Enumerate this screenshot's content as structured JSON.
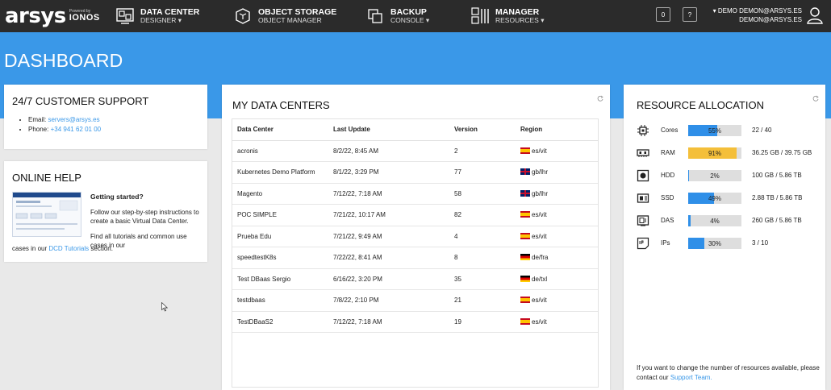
{
  "topbar": {
    "brand": "arsys",
    "brand_powered": "Powered by",
    "brand_ionos": "IONOS",
    "nav": [
      {
        "title": "DATA CENTER",
        "sub": "DESIGNER ▾",
        "icon": "data-center-designer-icon"
      },
      {
        "title": "OBJECT STORAGE",
        "sub": "OBJECT MANAGER",
        "icon": "object-storage-icon"
      },
      {
        "title": "BACKUP",
        "sub": "CONSOLE ▾",
        "icon": "backup-icon"
      },
      {
        "title": "MANAGER",
        "sub": "RESOURCES ▾",
        "icon": "manager-icon"
      }
    ],
    "badge_count": "0",
    "help_label": "?",
    "user_line1": "▾ DEMO DEMON@ARSYS.ES",
    "user_line2": "DEMON@ARSYS.ES"
  },
  "page": {
    "title": "DASHBOARD"
  },
  "support": {
    "title": "24/7 CUSTOMER SUPPORT",
    "email_label": "Email:",
    "email": "servers@arsys.es",
    "phone_label": "Phone:",
    "phone": "+34 941 62 01 00"
  },
  "help": {
    "title": "ONLINE HELP",
    "heading": "Getting started?",
    "text1": "Follow our step-by-step instructions to create a basic Virtual Data Center.",
    "text2_a": "Find all tutorials and common use cases in our",
    "text2_link": "DCD Tutorials",
    "text2_b": "section."
  },
  "datacenters": {
    "title": "MY DATA CENTERS",
    "columns": [
      "Data Center",
      "Last Update",
      "Version",
      "Region"
    ],
    "rows": [
      {
        "name": "acronis",
        "updated": "8/2/22, 8:45 AM",
        "version": "2",
        "flag": "es",
        "region": "es/vit"
      },
      {
        "name": "Kubernetes Demo Platform",
        "updated": "8/1/22, 3:29 PM",
        "version": "77",
        "flag": "gb",
        "region": "gb/lhr"
      },
      {
        "name": "Magento",
        "updated": "7/12/22, 7:18 AM",
        "version": "58",
        "flag": "gb",
        "region": "gb/lhr"
      },
      {
        "name": "POC SIMPLE",
        "updated": "7/21/22, 10:17 AM",
        "version": "82",
        "flag": "es",
        "region": "es/vit"
      },
      {
        "name": "Prueba Edu",
        "updated": "7/21/22, 9:49 AM",
        "version": "4",
        "flag": "es",
        "region": "es/vit"
      },
      {
        "name": "speedtestK8s",
        "updated": "7/22/22, 8:41 AM",
        "version": "8",
        "flag": "de",
        "region": "de/fra"
      },
      {
        "name": "Test DBaas Sergio",
        "updated": "6/16/22, 3:20 PM",
        "version": "35",
        "flag": "de",
        "region": "de/txl"
      },
      {
        "name": "testdbaas",
        "updated": "7/8/22, 2:10 PM",
        "version": "21",
        "flag": "es",
        "region": "es/vit"
      },
      {
        "name": "TestDBaaS2",
        "updated": "7/12/22, 7:18 AM",
        "version": "19",
        "flag": "es",
        "region": "es/vit"
      }
    ]
  },
  "resources": {
    "title": "RESOURCE ALLOCATION",
    "items": [
      {
        "label": "Cores",
        "pct": 55,
        "pct_label": "55%",
        "value": "22 / 40",
        "icon": "cpu-icon"
      },
      {
        "label": "RAM",
        "pct": 91,
        "pct_label": "91%",
        "value": "36.25 GB / 39.75 GB",
        "icon": "ram-icon"
      },
      {
        "label": "HDD",
        "pct": 2,
        "pct_label": "2%",
        "value": "100 GB / 5.86 TB",
        "icon": "hdd-icon"
      },
      {
        "label": "SSD",
        "pct": 49,
        "pct_label": "49%",
        "value": "2.88 TB / 5.86 TB",
        "icon": "ssd-icon"
      },
      {
        "label": "DAS",
        "pct": 4,
        "pct_label": "4%",
        "value": "260 GB / 5.86 TB",
        "icon": "das-icon"
      },
      {
        "label": "IPs",
        "pct": 30,
        "pct_label": "30%",
        "value": "3 / 10",
        "icon": "ip-icon"
      }
    ],
    "note_a": "If you want to change the number of resources available, please contact our",
    "note_link": "Support Team."
  },
  "colors": {
    "accent": "#3a98e8",
    "topbar": "#2b2b2b",
    "bar_fill": "#2f8fe8",
    "bar_warn": "#f4bf3a"
  }
}
